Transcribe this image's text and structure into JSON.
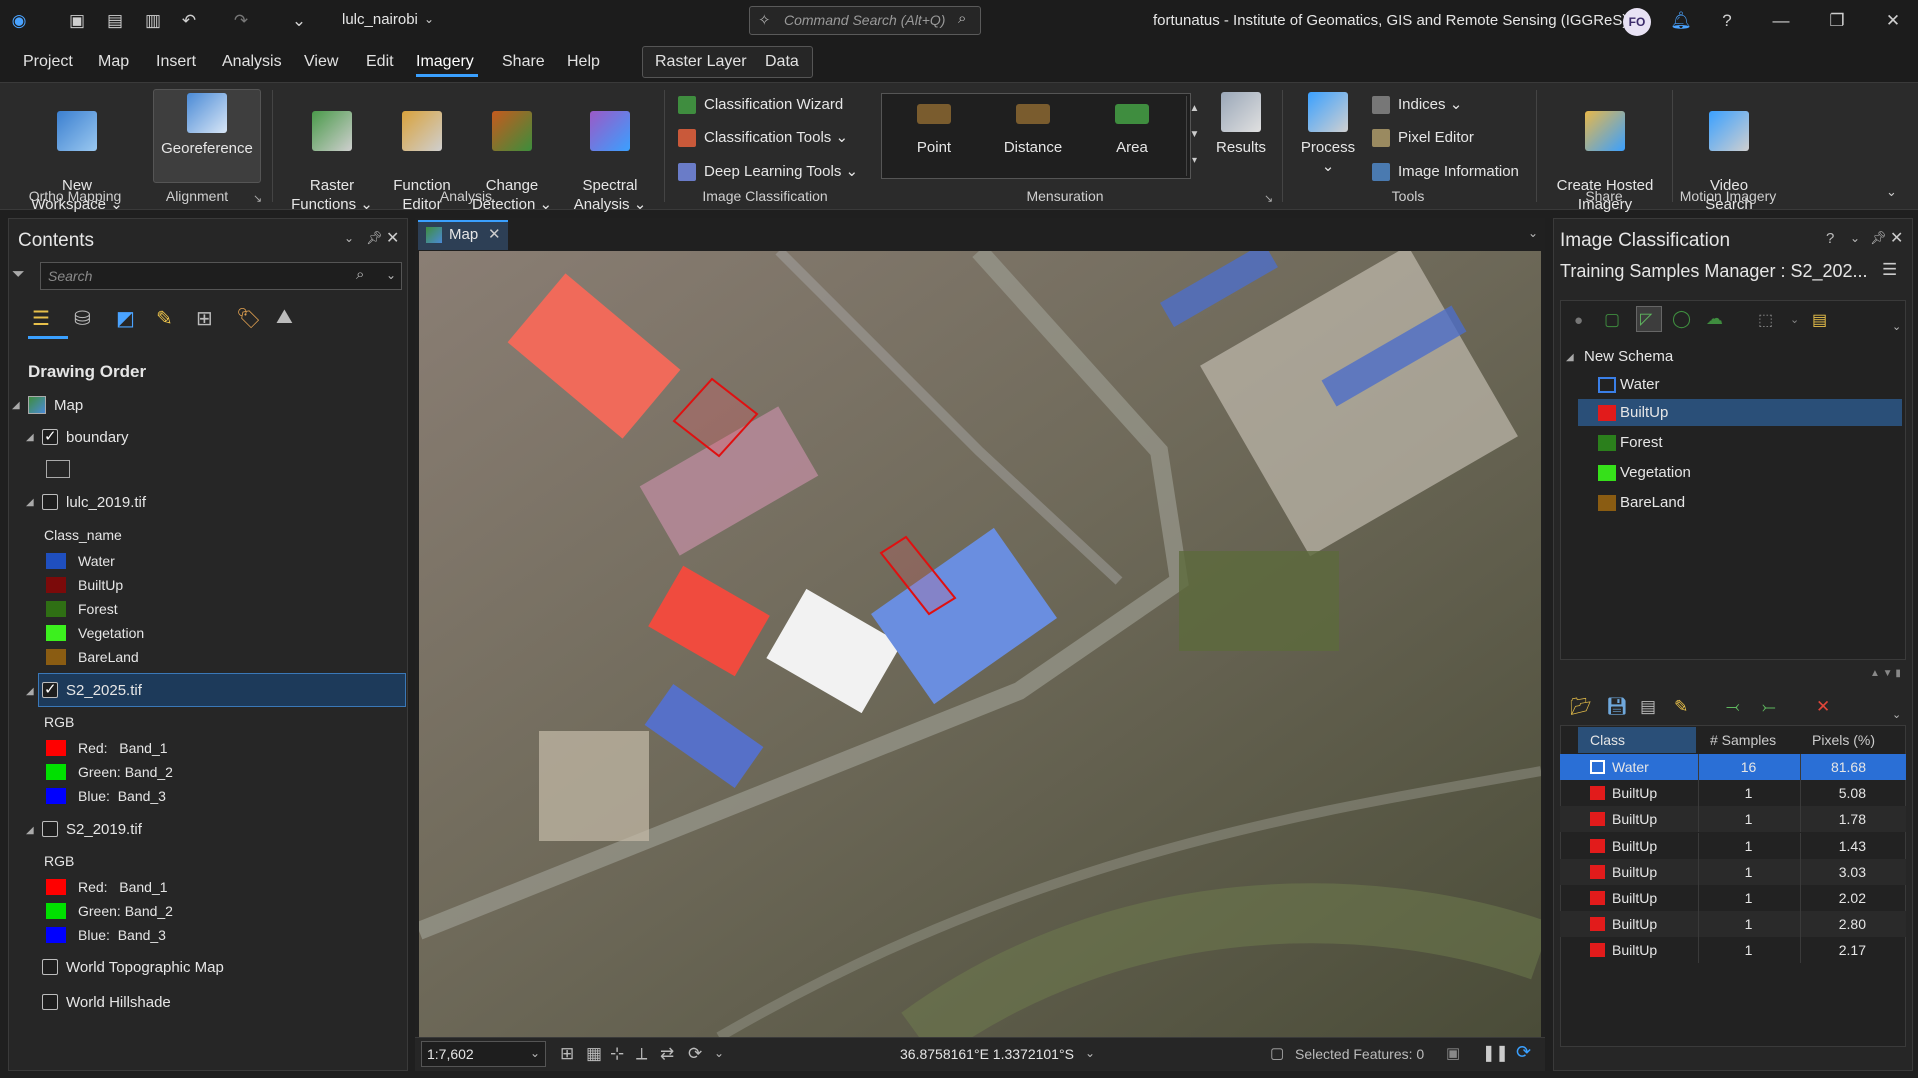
{
  "titlebar": {
    "project_name": "lulc_nairobi",
    "search_placeholder": "Command Search (Alt+Q)",
    "user_title": "fortunatus - Institute of Geomatics, GIS and Remote Sensing (IGGReS)",
    "avatar": "FO"
  },
  "menu": [
    "Project",
    "Map",
    "Insert",
    "Analysis",
    "View",
    "Edit",
    "Imagery",
    "Share",
    "Help"
  ],
  "context_tabs": {
    "group": "Raster Layer",
    "tab": "Data"
  },
  "ribbon": {
    "new_workspace": "New\nWorkspace",
    "georeference": "Georeference",
    "raster_functions": "Raster\nFunctions",
    "function_editor": "Function\nEditor",
    "change_detection": "Change\nDetection",
    "spectral_analysis": "Spectral\nAnalysis",
    "classification_wizard": "Classification Wizard",
    "classification_tools": "Classification Tools",
    "deep_learning_tools": "Deep Learning Tools",
    "point": "Point",
    "distance": "Distance",
    "area": "Area",
    "results": "Results",
    "process": "Process",
    "indices": "Indices",
    "pixel_editor": "Pixel Editor",
    "image_information": "Image Information",
    "create_hosted_imagery": "Create Hosted\nImagery",
    "video_search": "Video\nSearch",
    "groups": {
      "ortho": "Ortho Mapping",
      "alignment": "Alignment",
      "analysis": "Analysis",
      "image_classification": "Image Classification",
      "mensuration": "Mensuration",
      "tools": "Tools",
      "share": "Share",
      "motion": "Motion Imagery"
    }
  },
  "contents": {
    "title": "Contents",
    "search_placeholder": "Search",
    "drawing_order": "Drawing Order",
    "map": "Map",
    "boundary": "boundary",
    "lulc": "lulc_2019.tif",
    "class_name": "Class_name",
    "classes": [
      "Water",
      "BuiltUp",
      "Forest",
      "Vegetation",
      "BareLand"
    ],
    "class_colors": [
      "#1f4fbf",
      "#7b0a0a",
      "#2f6f14",
      "#3cf01e",
      "#8a5c12"
    ],
    "s2_2025": "S2_2025.tif",
    "rgb": "RGB",
    "bands": [
      "Red:   Band_1",
      "Green: Band_2",
      "Blue:  Band_3"
    ],
    "s2_2019": "S2_2019.tif",
    "world_topo": "World Topographic Map",
    "world_hillshade": "World Hillshade"
  },
  "map": {
    "tab": "Map",
    "scale": "1:7,602",
    "coords": "36.8758161°E 1.3372101°S",
    "selected": "Selected Features: 0"
  },
  "classification": {
    "title": "Image Classification",
    "subtitle": "Training Samples Manager : S2_202...",
    "schema": "New Schema",
    "classes": [
      "Water",
      "BuiltUp",
      "Forest",
      "Vegetation",
      "BareLand"
    ],
    "class_colors": [
      "#1f5fd0",
      "#e21b1b",
      "#2b7f1c",
      "#36e01a",
      "#8a5c12"
    ]
  },
  "samples_table": {
    "headers": [
      "Class",
      "# Samples",
      "Pixels (%)"
    ],
    "rows": [
      {
        "cls": "Water",
        "n": "16",
        "pct": "81.68",
        "color": "#1f5fd0"
      },
      {
        "cls": "BuiltUp",
        "n": "1",
        "pct": "5.08",
        "color": "#e21b1b"
      },
      {
        "cls": "BuiltUp",
        "n": "1",
        "pct": "1.78",
        "color": "#e21b1b"
      },
      {
        "cls": "BuiltUp",
        "n": "1",
        "pct": "1.43",
        "color": "#e21b1b"
      },
      {
        "cls": "BuiltUp",
        "n": "1",
        "pct": "3.03",
        "color": "#e21b1b"
      },
      {
        "cls": "BuiltUp",
        "n": "1",
        "pct": "2.02",
        "color": "#e21b1b"
      },
      {
        "cls": "BuiltUp",
        "n": "1",
        "pct": "2.80",
        "color": "#e21b1b"
      },
      {
        "cls": "BuiltUp",
        "n": "1",
        "pct": "2.17",
        "color": "#e21b1b"
      }
    ]
  }
}
